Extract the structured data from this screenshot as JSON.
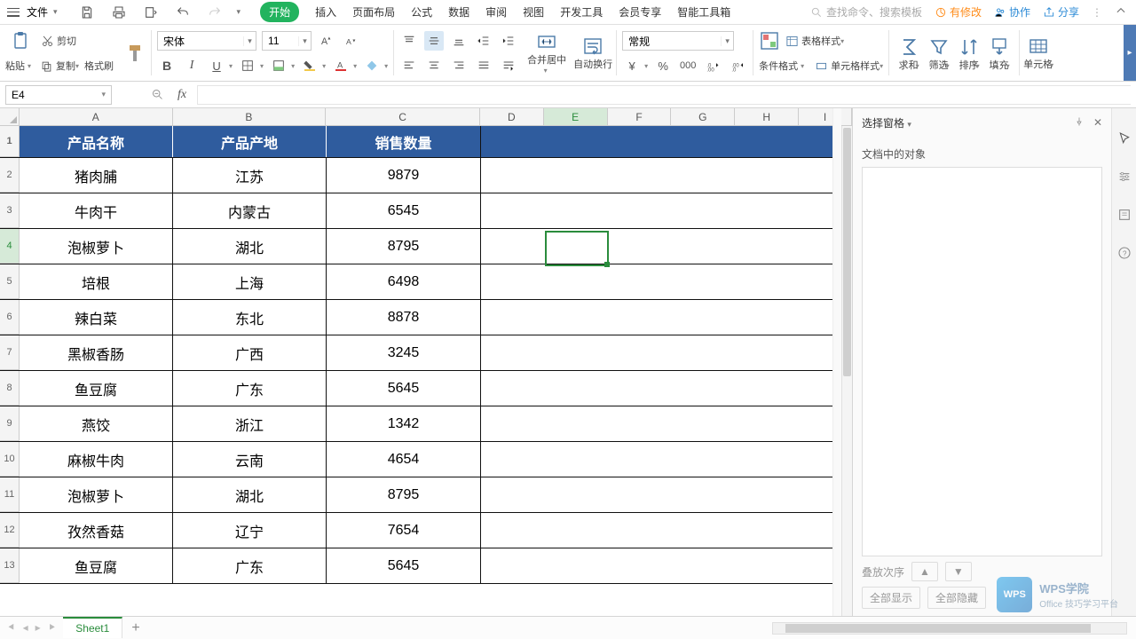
{
  "menubar": {
    "file": "文件",
    "tabs": [
      "开始",
      "插入",
      "页面布局",
      "公式",
      "数据",
      "审阅",
      "视图",
      "开发工具",
      "会员专享",
      "智能工具箱"
    ],
    "active_tab": 0,
    "search_placeholder": "查找命令、搜索模板",
    "right_items": {
      "修改": "有修改",
      "协作": "协作",
      "分享": "分享"
    }
  },
  "ribbon": {
    "clipboard": {
      "cut": "剪切",
      "copy": "复制",
      "paste": "粘贴",
      "painter": "格式刷"
    },
    "font": {
      "name": "宋体",
      "size": "11"
    },
    "number_format": "常规",
    "merge": "合并居中",
    "wrap": "自动换行",
    "cond_format": "条件格式",
    "table_style": "表格样式",
    "cell_style": "单元格样式",
    "sum": "求和",
    "filter": "筛选",
    "sort": "排序",
    "fill": "填充",
    "cell": "单元格"
  },
  "formula_bar": {
    "name_box": "E4",
    "formula": ""
  },
  "grid": {
    "columns": [
      "A",
      "B",
      "C",
      "D",
      "E",
      "F",
      "G",
      "H",
      "I"
    ],
    "active_col": "E",
    "active_row": 4,
    "row_numbers": [
      1,
      2,
      3,
      4,
      5,
      6,
      7,
      8,
      9,
      10,
      11,
      12,
      13
    ],
    "header": {
      "c1": "产品名称",
      "c2": "产品产地",
      "c3": "销售数量"
    },
    "rows": [
      {
        "c1": "猪肉脯",
        "c2": "江苏",
        "c3": "9879"
      },
      {
        "c1": "牛肉干",
        "c2": "内蒙古",
        "c3": "6545"
      },
      {
        "c1": "泡椒萝卜",
        "c2": "湖北",
        "c3": "8795"
      },
      {
        "c1": "培根",
        "c2": "上海",
        "c3": "6498"
      },
      {
        "c1": "辣白菜",
        "c2": "东北",
        "c3": "8878"
      },
      {
        "c1": "黑椒香肠",
        "c2": "广西",
        "c3": "3245"
      },
      {
        "c1": "鱼豆腐",
        "c2": "广东",
        "c3": "5645"
      },
      {
        "c1": "燕饺",
        "c2": "浙江",
        "c3": "1342"
      },
      {
        "c1": "麻椒牛肉",
        "c2": "云南",
        "c3": "4654"
      },
      {
        "c1": "泡椒萝卜",
        "c2": "湖北",
        "c3": "8795"
      },
      {
        "c1": "孜然香菇",
        "c2": "辽宁",
        "c3": "7654"
      },
      {
        "c1": "鱼豆腐",
        "c2": "广东",
        "c3": "5645"
      }
    ]
  },
  "panel": {
    "title": "选择窗格",
    "subtitle": "文档中的对象",
    "stack": "叠放次序",
    "show_all": "全部显示",
    "hide_all": "全部隐藏"
  },
  "sheetbar": {
    "sheet": "Sheet1"
  },
  "watermark": {
    "brand": "WPS",
    "text1": "WPS学院",
    "text2": "Office 技巧学习平台"
  }
}
